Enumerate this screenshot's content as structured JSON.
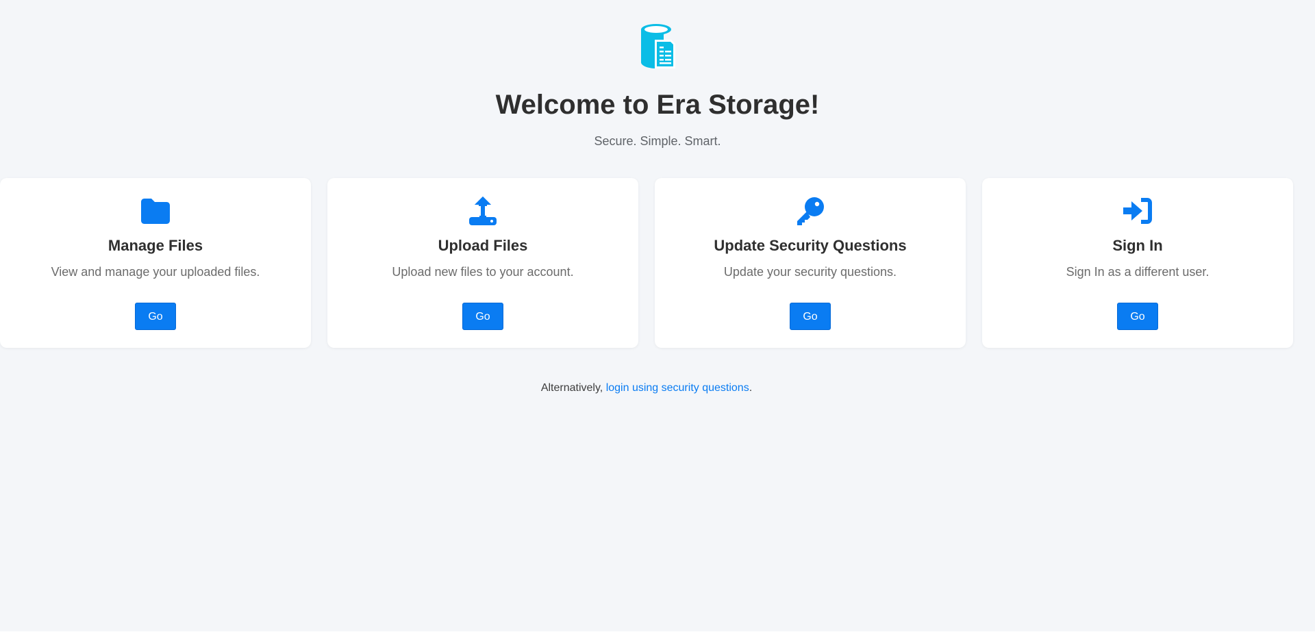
{
  "header": {
    "logo_icon": "database-document-icon",
    "title": "Welcome to Era Storage!",
    "subtitle": "Secure. Simple. Smart."
  },
  "cards": [
    {
      "icon": "folder-icon",
      "title": "Manage Files",
      "description": "View and manage your uploaded files.",
      "button_label": "Go"
    },
    {
      "icon": "upload-icon",
      "title": "Upload Files",
      "description": "Upload new files to your account.",
      "button_label": "Go"
    },
    {
      "icon": "key-icon",
      "title": "Update Security Questions",
      "description": "Update your security questions.",
      "button_label": "Go"
    },
    {
      "icon": "sign-in-icon",
      "title": "Sign In",
      "description": "Sign In as a different user.",
      "button_label": "Go"
    }
  ],
  "footer": {
    "prefix": "Alternatively, ",
    "link_text": "login using security questions",
    "suffix": "."
  },
  "colors": {
    "background": "#f4f6f9",
    "accent": "#0a7cf2",
    "logo": "#0bbde6"
  }
}
